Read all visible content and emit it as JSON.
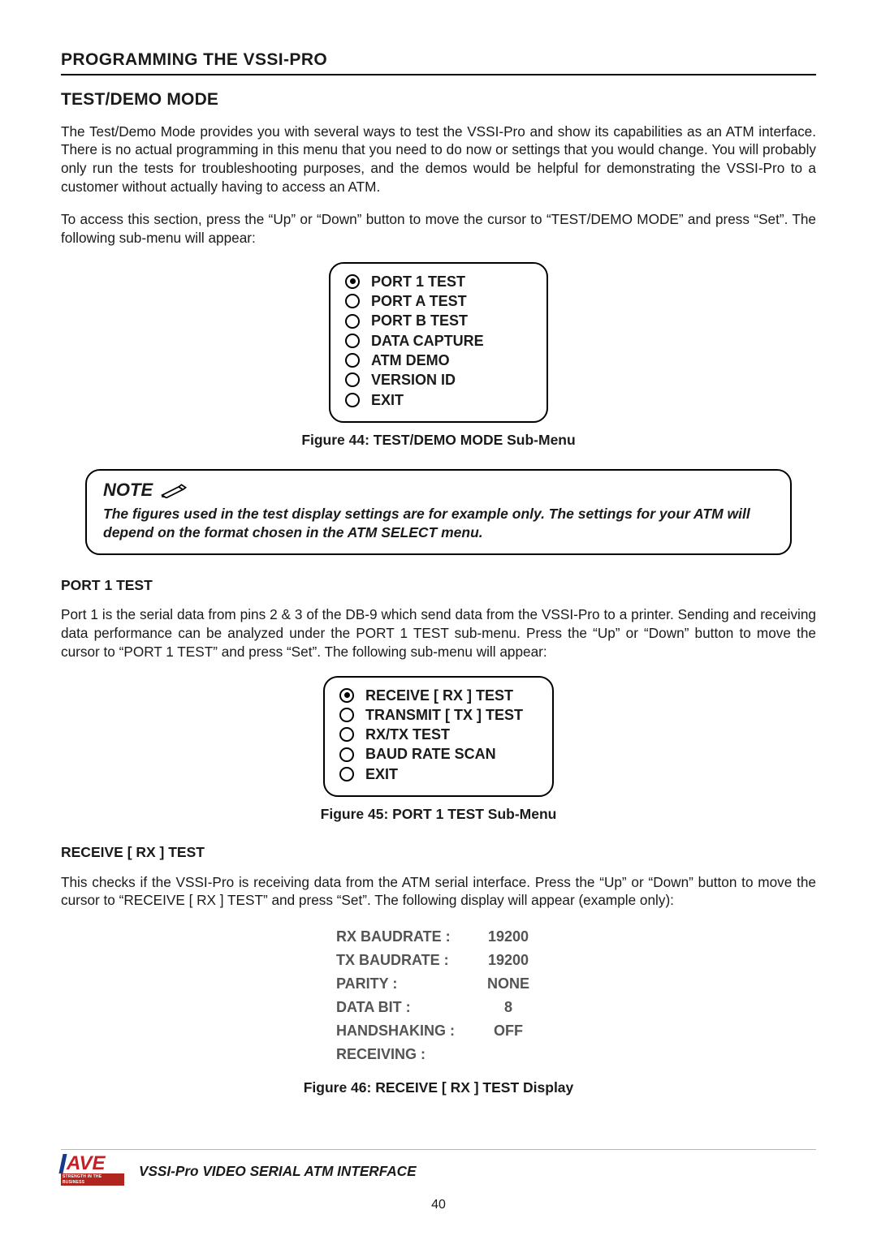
{
  "header": {
    "title": "PROGRAMMING THE VSSI-PRO"
  },
  "section1": {
    "title": "TEST/DEMO MODE",
    "p1": "The Test/Demo Mode provides you with several ways to test the VSSI-Pro and show its capabilities as an ATM interface. There is no actual programming in this menu that you need to do now or settings that you would change. You will probably only run the tests for troubleshooting purposes, and the demos would be helpful for demonstrating the VSSI-Pro to a customer without actually having to access an ATM.",
    "p2": "To access this section, press the “Up” or “Down” button to move the cursor to “TEST/DEMO MODE” and press “Set”. The following sub-menu will appear:"
  },
  "submenu_testdemo": {
    "items": [
      {
        "label": "PORT 1 TEST",
        "selected": true
      },
      {
        "label": "PORT A TEST",
        "selected": false
      },
      {
        "label": "PORT B TEST",
        "selected": false
      },
      {
        "label": "DATA CAPTURE",
        "selected": false
      },
      {
        "label": "ATM DEMO",
        "selected": false
      },
      {
        "label": "VERSION ID",
        "selected": false
      },
      {
        "label": "EXIT",
        "selected": false
      }
    ],
    "caption": "Figure 44: TEST/DEMO MODE Sub-Menu"
  },
  "note": {
    "title": "NOTE",
    "text": "The figures used in the test display settings are for example only. The settings for your ATM will depend on the format chosen in the ATM SELECT menu."
  },
  "port1": {
    "heading": "PORT 1 TEST",
    "p1": "Port 1 is the serial data from pins 2 & 3 of the DB-9 which send data from the VSSI-Pro to a printer. Sending and receiving data performance can be analyzed under the PORT 1 TEST sub-menu. Press the “Up” or “Down” button to move the cursor to “PORT 1 TEST” and press “Set”.  The following sub-menu will appear:"
  },
  "submenu_port1": {
    "items": [
      {
        "label": "RECEIVE [ RX ] TEST",
        "selected": true
      },
      {
        "label": "TRANSMIT [ TX ] TEST",
        "selected": false
      },
      {
        "label": "RX/TX TEST",
        "selected": false
      },
      {
        "label": "BAUD RATE SCAN",
        "selected": false
      },
      {
        "label": "EXIT",
        "selected": false
      }
    ],
    "caption": "Figure 45: PORT 1 TEST Sub-Menu"
  },
  "rxtest": {
    "heading": "RECEIVE [ RX ] TEST",
    "p1": "This checks if the VSSI-Pro is receiving data from the  ATM serial interface. Press the “Up” or “Down” button to move the cursor to “RECEIVE [ RX ] TEST” and press “Set”. The following display will appear (example only):"
  },
  "rx_display": {
    "rows": [
      {
        "k": "RX BAUDRATE :",
        "v": "19200"
      },
      {
        "k": "TX BAUDRATE :",
        "v": "19200"
      },
      {
        "k": "PARITY :",
        "v": "NONE"
      },
      {
        "k": "DATA BIT :",
        "v": "8"
      },
      {
        "k": "HANDSHAKING :",
        "v": "OFF"
      },
      {
        "k": "RECEIVING :",
        "v": ""
      }
    ],
    "caption": "Figure 46: RECEIVE [ RX ] TEST Display"
  },
  "footer": {
    "logo_main": "AVE",
    "logo_sub": "STRENGTH IN THE BUSINESS",
    "product": "VSSI-Pro VIDEO SERIAL ATM INTERFACE",
    "page_number": "40"
  }
}
